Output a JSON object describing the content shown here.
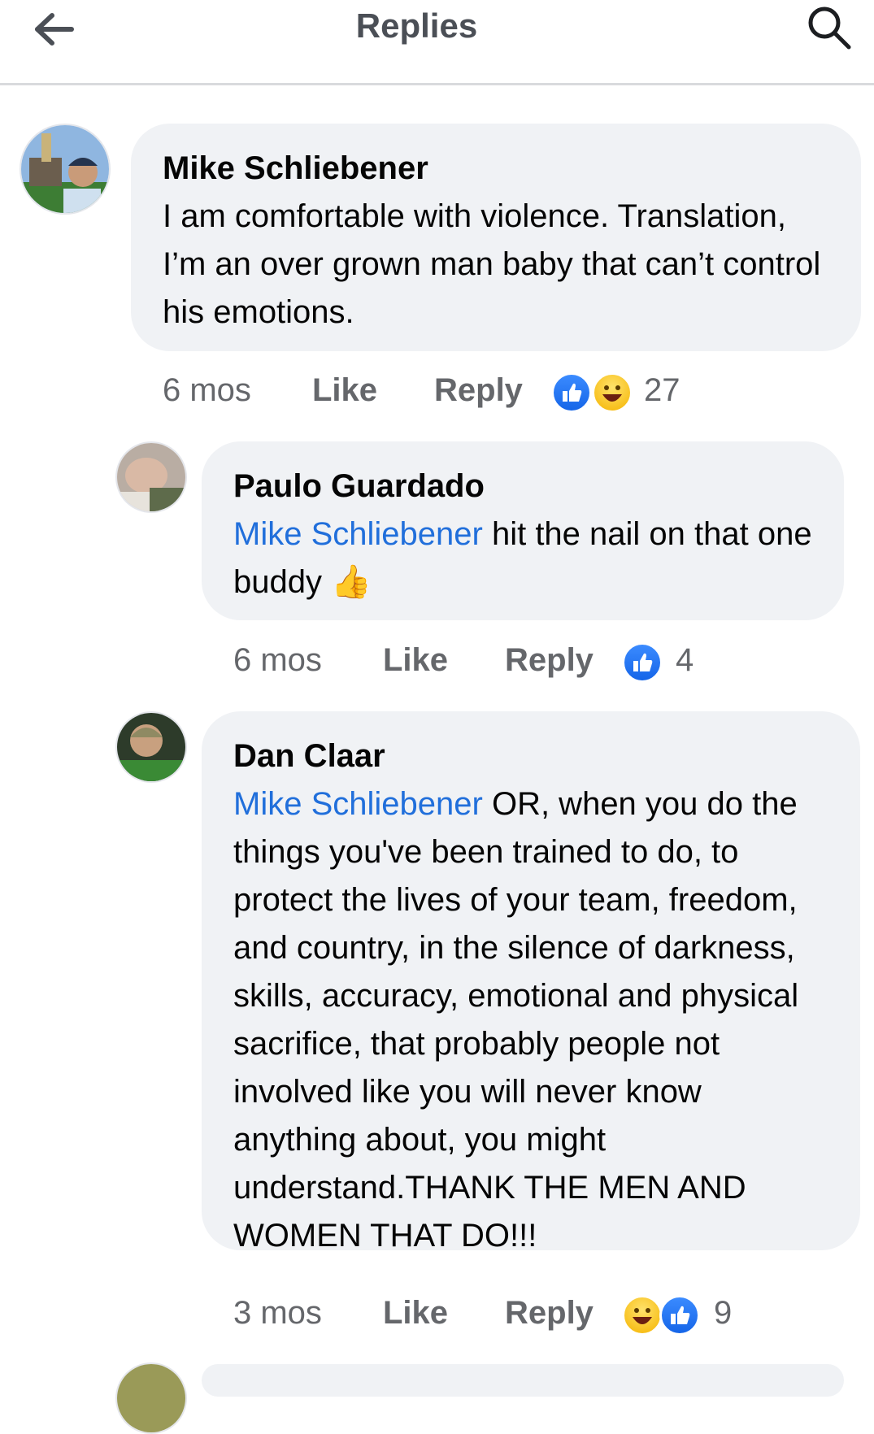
{
  "header": {
    "title": "Replies",
    "back_icon": "arrow-left-icon",
    "search_icon": "search-icon"
  },
  "comments": [
    {
      "author": "Mike Schliebener",
      "text": "I am comfortable with violence. Translation, I’m an over grown man baby that can’t control his emotions.",
      "time": "6 mos",
      "like_label": "Like",
      "reply_label": "Reply",
      "reaction_count": "27",
      "reactions": [
        "like",
        "haha"
      ]
    },
    {
      "author": "Paulo Guardado",
      "mention": "Mike Schliebener",
      "text": "hit the nail on that one buddy",
      "emoji": "👍",
      "time": "6 mos",
      "like_label": "Like",
      "reply_label": "Reply",
      "reaction_count": "4",
      "reactions": [
        "like"
      ]
    },
    {
      "author": "Dan Claar",
      "mention": "Mike Schliebener",
      "text": "OR, when you do the things you've been trained to do, to protect the lives of your team, freedom, and country, in the silence of darkness, skills, accuracy, emotional and physical sacrifice, that probably people not involved like you will never know anything about, you might understand.THANK THE MEN AND WOMEN THAT DO!!!",
      "time": "3 mos",
      "like_label": "Like",
      "reply_label": "Reply",
      "reaction_count": "9",
      "reactions": [
        "haha",
        "like"
      ]
    }
  ],
  "colors": {
    "mention": "#216fdb",
    "bubble": "#f0f2f5",
    "meta": "#65676b",
    "like_blue": "#1877f2"
  }
}
